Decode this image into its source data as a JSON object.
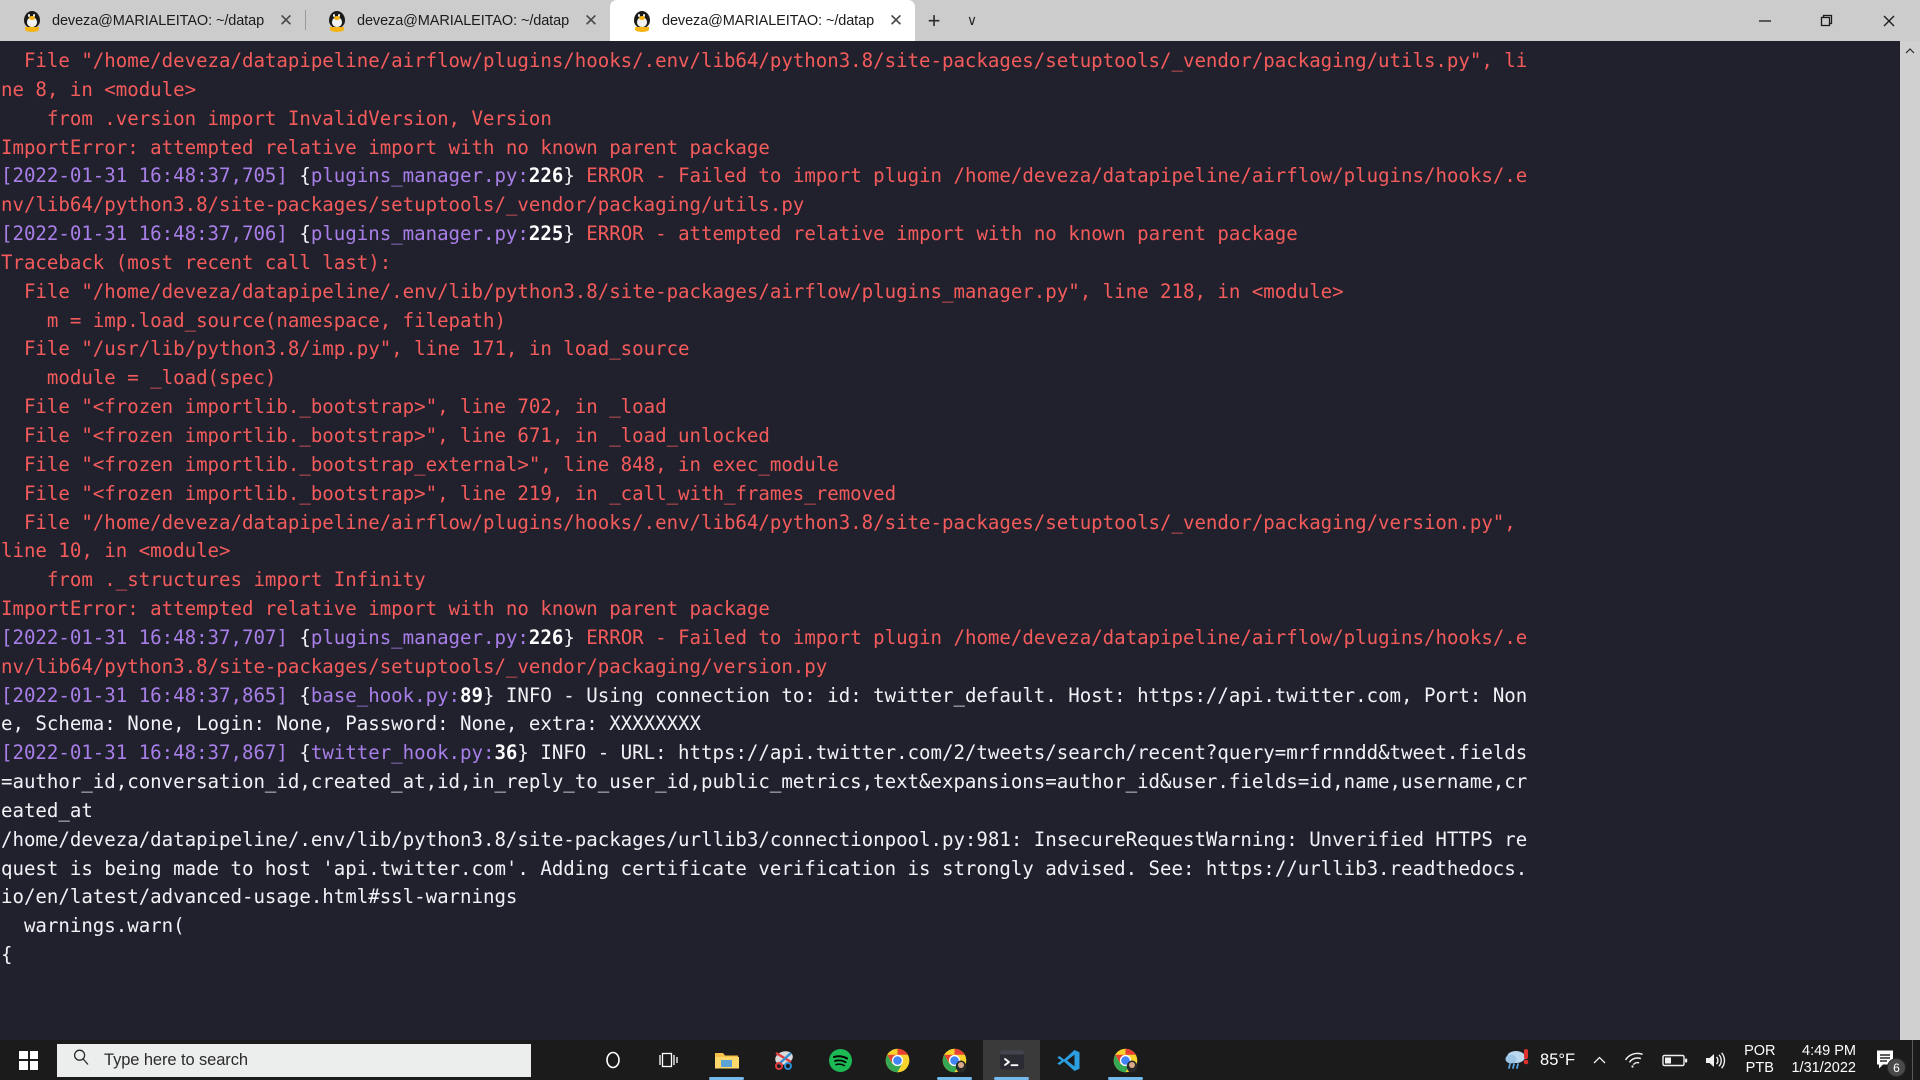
{
  "window": {
    "tabs": [
      {
        "title": "deveza@MARIALEITAO: ~/datap",
        "close": "✕",
        "active": false
      },
      {
        "title": "deveza@MARIALEITAO: ~/datap",
        "close": "✕",
        "active": false
      },
      {
        "title": "deveza@MARIALEITAO: ~/datap",
        "close": "✕",
        "active": true
      }
    ],
    "new_tab_label": "+",
    "tab_menu_label": "∨",
    "controls": {
      "minimize": "minimize-icon",
      "restore": "restore-icon",
      "close": "close-icon"
    }
  },
  "terminal": {
    "lines": [
      [
        {
          "t": "  File \"/home/deveza/datapipeline/airflow/plugins/hooks/.env/lib64/python3.8/site-packages/setuptools/_vendor/packaging/utils.py\", li",
          "c": "red"
        }
      ],
      [
        {
          "t": "ne 8, in <module>",
          "c": "red"
        }
      ],
      [
        {
          "t": "    from .version import InvalidVersion, Version",
          "c": "red"
        }
      ],
      [
        {
          "t": "ImportError: attempted relative import with no known parent package",
          "c": "red"
        }
      ],
      [
        {
          "t": "[2022-01-31 16:48:37,705]",
          "c": "vio"
        },
        {
          "t": " {",
          "c": "wht"
        },
        {
          "t": "plugins_manager.py:",
          "c": "vio"
        },
        {
          "t": "226",
          "c": "bwht"
        },
        {
          "t": "} ",
          "c": "wht"
        },
        {
          "t": "ERROR - Failed to import plugin /home/deveza/datapipeline/airflow/plugins/hooks/.e",
          "c": "red"
        }
      ],
      [
        {
          "t": "nv/lib64/python3.8/site-packages/setuptools/_vendor/packaging/utils.py",
          "c": "red"
        }
      ],
      [
        {
          "t": "[2022-01-31 16:48:37,706]",
          "c": "vio"
        },
        {
          "t": " {",
          "c": "wht"
        },
        {
          "t": "plugins_manager.py:",
          "c": "vio"
        },
        {
          "t": "225",
          "c": "bwht"
        },
        {
          "t": "} ",
          "c": "wht"
        },
        {
          "t": "ERROR - attempted relative import with no known parent package",
          "c": "red"
        }
      ],
      [
        {
          "t": "Traceback (most recent call last):",
          "c": "red"
        }
      ],
      [
        {
          "t": "  File \"/home/deveza/datapipeline/.env/lib/python3.8/site-packages/airflow/plugins_manager.py\", line 218, in <module>",
          "c": "red"
        }
      ],
      [
        {
          "t": "    m = imp.load_source(namespace, filepath)",
          "c": "red"
        }
      ],
      [
        {
          "t": "  File \"/usr/lib/python3.8/imp.py\", line 171, in load_source",
          "c": "red"
        }
      ],
      [
        {
          "t": "    module = _load(spec)",
          "c": "red"
        }
      ],
      [
        {
          "t": "  File \"<frozen importlib._bootstrap>\", line 702, in _load",
          "c": "red"
        }
      ],
      [
        {
          "t": "  File \"<frozen importlib._bootstrap>\", line 671, in _load_unlocked",
          "c": "red"
        }
      ],
      [
        {
          "t": "  File \"<frozen importlib._bootstrap_external>\", line 848, in exec_module",
          "c": "red"
        }
      ],
      [
        {
          "t": "  File \"<frozen importlib._bootstrap>\", line 219, in _call_with_frames_removed",
          "c": "red"
        }
      ],
      [
        {
          "t": "  File \"/home/deveza/datapipeline/airflow/plugins/hooks/.env/lib64/python3.8/site-packages/setuptools/_vendor/packaging/version.py\",",
          "c": "red"
        }
      ],
      [
        {
          "t": "line 10, in <module>",
          "c": "red"
        }
      ],
      [
        {
          "t": "    from ._structures import Infinity",
          "c": "red"
        }
      ],
      [
        {
          "t": "ImportError: attempted relative import with no known parent package",
          "c": "red"
        }
      ],
      [
        {
          "t": "[2022-01-31 16:48:37,707]",
          "c": "vio"
        },
        {
          "t": " {",
          "c": "wht"
        },
        {
          "t": "plugins_manager.py:",
          "c": "vio"
        },
        {
          "t": "226",
          "c": "bwht"
        },
        {
          "t": "} ",
          "c": "wht"
        },
        {
          "t": "ERROR - Failed to import plugin /home/deveza/datapipeline/airflow/plugins/hooks/.e",
          "c": "red"
        }
      ],
      [
        {
          "t": "nv/lib64/python3.8/site-packages/setuptools/_vendor/packaging/version.py",
          "c": "red"
        }
      ],
      [
        {
          "t": "[2022-01-31 16:48:37,865]",
          "c": "vio"
        },
        {
          "t": " {",
          "c": "wht"
        },
        {
          "t": "base_hook.py:",
          "c": "vio"
        },
        {
          "t": "89",
          "c": "bwht"
        },
        {
          "t": "} INFO - Using connection to: id: twitter_default. Host: https://api.twitter.com, Port: Non",
          "c": "wht"
        }
      ],
      [
        {
          "t": "e, Schema: None, Login: None, Password: None, extra: XXXXXXXX",
          "c": "wht"
        }
      ],
      [
        {
          "t": "[2022-01-31 16:48:37,867]",
          "c": "vio"
        },
        {
          "t": " {",
          "c": "wht"
        },
        {
          "t": "twitter_hook.py:",
          "c": "vio"
        },
        {
          "t": "36",
          "c": "bwht"
        },
        {
          "t": "} INFO - URL: https://api.twitter.com/2/tweets/search/recent?query=mrfrnndd&tweet.fields",
          "c": "wht"
        }
      ],
      [
        {
          "t": "=author_id,conversation_id,created_at,id,in_reply_to_user_id,public_metrics,text&expansions=author_id&user.fields=id,name,username,cr",
          "c": "wht"
        }
      ],
      [
        {
          "t": "eated_at",
          "c": "wht"
        }
      ],
      [
        {
          "t": "/home/deveza/datapipeline/.env/lib/python3.8/site-packages/urllib3/connectionpool.py:981: InsecureRequestWarning: Unverified HTTPS re",
          "c": "wht"
        }
      ],
      [
        {
          "t": "quest is being made to host 'api.twitter.com'. Adding certificate verification is strongly advised. See: https://urllib3.readthedocs.",
          "c": "wht"
        }
      ],
      [
        {
          "t": "io/en/latest/advanced-usage.html#ssl-warnings",
          "c": "wht"
        }
      ],
      [
        {
          "t": "  warnings.warn(",
          "c": "wht"
        }
      ],
      [
        {
          "t": "{",
          "c": "wht"
        }
      ]
    ]
  },
  "taskbar": {
    "start": "windows-start-icon",
    "search": {
      "placeholder": "Type here to search",
      "icon": "search-icon"
    },
    "items": [
      {
        "name": "cortana-icon",
        "active": false,
        "open": false
      },
      {
        "name": "task-view-icon",
        "active": false,
        "open": false
      },
      {
        "name": "file-explorer-icon",
        "active": false,
        "open": true
      },
      {
        "name": "snipping-tool-icon",
        "active": false,
        "open": false
      },
      {
        "name": "spotify-icon",
        "active": false,
        "open": false
      },
      {
        "name": "chrome-icon",
        "active": false,
        "open": false
      },
      {
        "name": "chrome-profile-icon",
        "active": false,
        "open": true
      },
      {
        "name": "terminal-icon",
        "active": true,
        "open": true
      },
      {
        "name": "vscode-icon",
        "active": false,
        "open": false
      },
      {
        "name": "chrome-profile-2-icon",
        "active": false,
        "open": true
      }
    ],
    "tray": {
      "weather_icon": "rain-alert-icon",
      "weather_temp": "85°F",
      "overflow_icon": "chevron-up-icon",
      "network_icon": "wifi-icon",
      "battery_icon": "battery-icon",
      "volume_icon": "volume-icon",
      "language_line1": "POR",
      "language_line2": "PTB",
      "time": "4:49 PM",
      "date": "1/31/2022",
      "notifications_icon": "notifications-icon",
      "notifications_count": "6"
    }
  }
}
